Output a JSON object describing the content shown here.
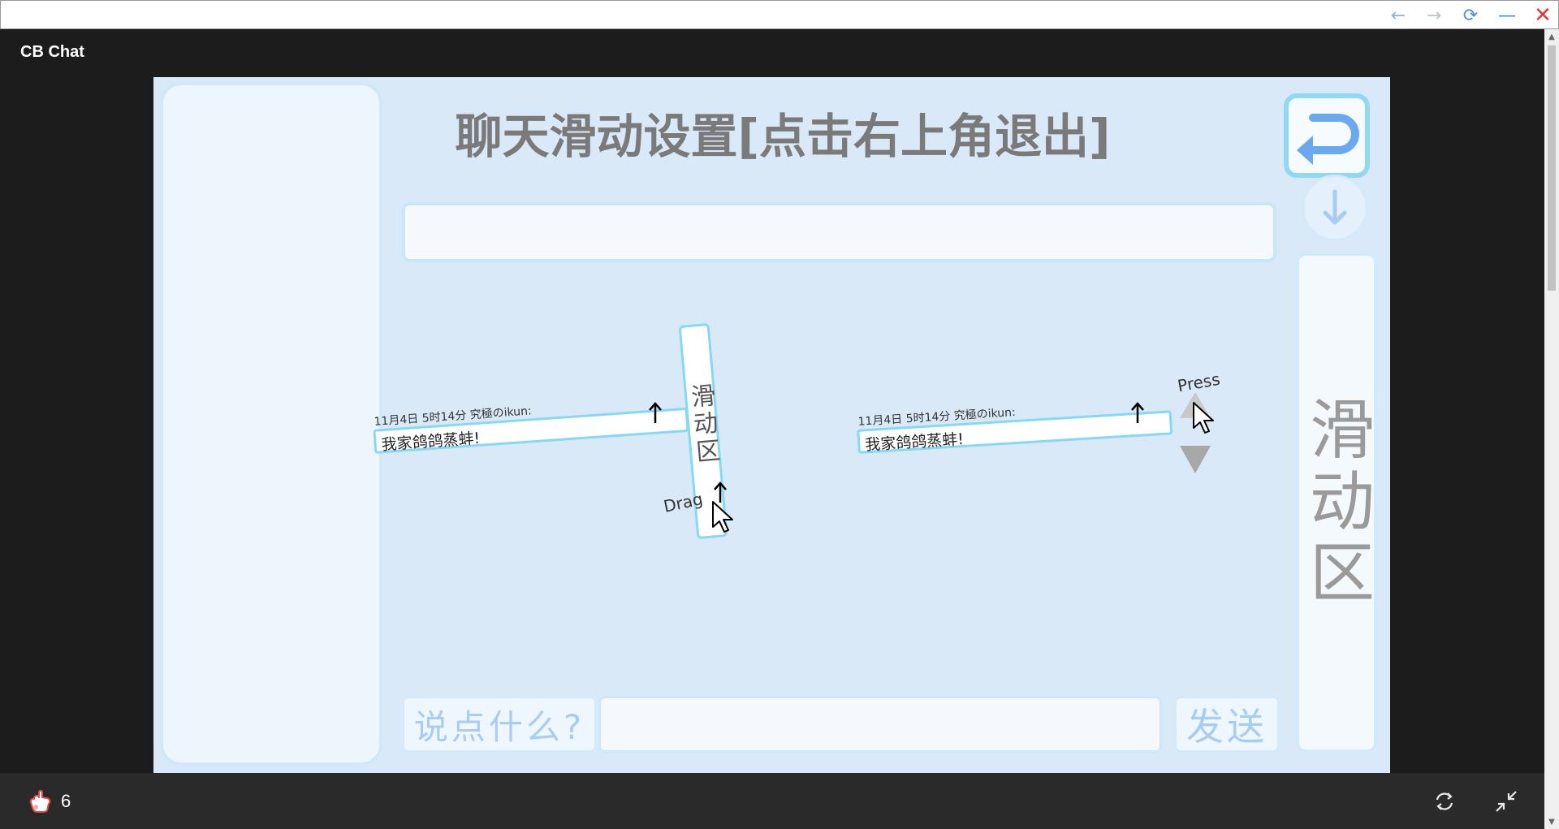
{
  "window": {
    "back_glyph": "←",
    "forward_glyph": "→",
    "reload_glyph": "⟳",
    "minimize_glyph": "—",
    "close_glyph": "✕"
  },
  "app": {
    "title": "CB Chat"
  },
  "game": {
    "title": "聊天滑动设置[点击右上角退出]",
    "scroll_area_label": "滑动区",
    "vertical_slider_label": "滑动区",
    "drag_hint": "Drag",
    "press_hint": "Press",
    "demo_message": {
      "meta": "11月4日 5时14分 究極のikun:",
      "text": "我家鸽鸽蒸蚌!"
    },
    "input": {
      "label": "说点什么?",
      "value": ""
    },
    "send_label": "发送"
  },
  "bottom": {
    "like_count": "6"
  },
  "icons": {
    "exit": "return-arrow-icon",
    "scroll_down": "down-arrow-icon",
    "like": "hand-icon",
    "sync": "sync-icon",
    "collapse": "collapse-icon"
  },
  "colors": {
    "game_background": "#dae9f8",
    "accent_border": "#87d8f5",
    "exit_arrow": "#6aa9f0",
    "title_gray": "#7a7a7a"
  }
}
